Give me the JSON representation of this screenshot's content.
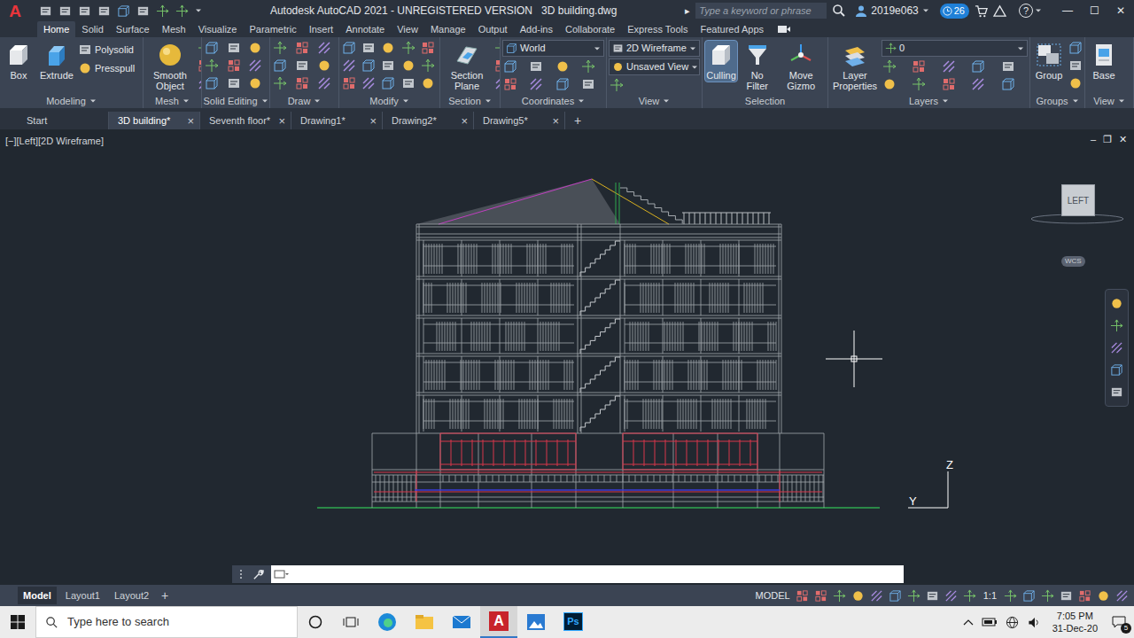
{
  "app": {
    "logo": "A",
    "title": "Autodesk AutoCAD 2021 - UNREGISTERED VERSION",
    "file": "3D building.dwg",
    "search_arrow": "▸",
    "search_placeholder": "Type a keyword or phrase",
    "user": "2019e063",
    "notifications": "26",
    "help": "?",
    "window_controls": [
      "—",
      "☐",
      "✕"
    ]
  },
  "menu_tabs": [
    {
      "label": "Home",
      "selected": true
    },
    {
      "label": "Solid",
      "selected": false
    },
    {
      "label": "Surface",
      "selected": false
    },
    {
      "label": "Mesh",
      "selected": false
    },
    {
      "label": "Visualize",
      "selected": false
    },
    {
      "label": "Parametric",
      "selected": false
    },
    {
      "label": "Insert",
      "selected": false
    },
    {
      "label": "Annotate",
      "selected": false
    },
    {
      "label": "View",
      "selected": false
    },
    {
      "label": "Manage",
      "selected": false
    },
    {
      "label": "Output",
      "selected": false
    },
    {
      "label": "Add-ins",
      "selected": false
    },
    {
      "label": "Collaborate",
      "selected": false
    },
    {
      "label": "Express Tools",
      "selected": false
    },
    {
      "label": "Featured Apps",
      "selected": false
    }
  ],
  "ribbon": {
    "panels": [
      {
        "label": "Modeling",
        "menu": true,
        "items": [
          {
            "kind": "large",
            "label": "Box",
            "active": false
          },
          {
            "kind": "large",
            "label": "Extrude",
            "active": false
          },
          {
            "kind": "small",
            "label": "Polysolid"
          },
          {
            "kind": "small",
            "label": "Presspull"
          }
        ]
      },
      {
        "label": "Mesh",
        "menu": true,
        "items": [
          {
            "kind": "large",
            "label": "Smooth Object",
            "active": false
          }
        ]
      },
      {
        "label": "Solid Editing",
        "menu": true,
        "items": []
      },
      {
        "label": "Draw",
        "menu": true,
        "items": []
      },
      {
        "label": "Modify",
        "menu": true,
        "items": []
      },
      {
        "label": "Section",
        "menu": true,
        "items": [
          {
            "kind": "large",
            "label": "Section Plane",
            "active": false
          }
        ]
      },
      {
        "label": "Coordinates",
        "menu": true,
        "items": [
          {
            "kind": "dropdown",
            "label": "World"
          }
        ]
      },
      {
        "label": "View",
        "menu": true,
        "items": [
          {
            "kind": "dropdown",
            "label": "2D Wireframe"
          },
          {
            "kind": "dropdown",
            "label": "Unsaved View"
          }
        ]
      },
      {
        "label": "Selection",
        "menu": false,
        "items": [
          {
            "kind": "large",
            "label": "Culling",
            "active": true
          },
          {
            "kind": "large",
            "label": "No Filter",
            "active": false
          },
          {
            "kind": "large",
            "label": "Move Gizmo",
            "active": false
          }
        ]
      },
      {
        "label": "Layers",
        "menu": true,
        "items": [
          {
            "kind": "large",
            "label": "Layer Properties",
            "active": false
          },
          {
            "kind": "dropdown",
            "label": "0"
          }
        ]
      },
      {
        "label": "Groups",
        "menu": true,
        "items": [
          {
            "kind": "large",
            "label": "Group",
            "active": false
          }
        ]
      },
      {
        "label": "View",
        "menu": true,
        "items": [
          {
            "kind": "large",
            "label": "Base",
            "active": false
          }
        ]
      }
    ]
  },
  "file_tabs": {
    "close": "×",
    "add": "+",
    "items": [
      {
        "label": "Start",
        "selected": false,
        "closable": false
      },
      {
        "label": "3D building*",
        "selected": true,
        "closable": true
      },
      {
        "label": "Seventh floor*",
        "selected": false,
        "closable": true
      },
      {
        "label": "Drawing1*",
        "selected": false,
        "closable": true
      },
      {
        "label": "Drawing2*",
        "selected": false,
        "closable": true
      },
      {
        "label": "Drawing5*",
        "selected": false,
        "closable": true
      }
    ]
  },
  "viewport": {
    "label": "[−][Left][2D Wireframe]",
    "controls": [
      "–",
      "❐",
      "✕"
    ],
    "viewcube": "LEFT",
    "ucs_badge": "WCS",
    "axes": {
      "z": "Z",
      "y": "Y"
    }
  },
  "layout_tabs": {
    "items": [
      {
        "label": "Model",
        "selected": true
      },
      {
        "label": "Layout1",
        "selected": false
      },
      {
        "label": "Layout2",
        "selected": false
      }
    ],
    "add": "+"
  },
  "status_bar": {
    "mode": "MODEL",
    "scale": "1:1"
  },
  "taskbar": {
    "search_placeholder": "Type here to search",
    "autocad": {
      "glyph": "A",
      "active": true
    },
    "photoshop": {
      "glyph": "Ps",
      "active": false
    },
    "time": "7:05 PM",
    "date": "31-Dec-20",
    "notifications": "5"
  }
}
